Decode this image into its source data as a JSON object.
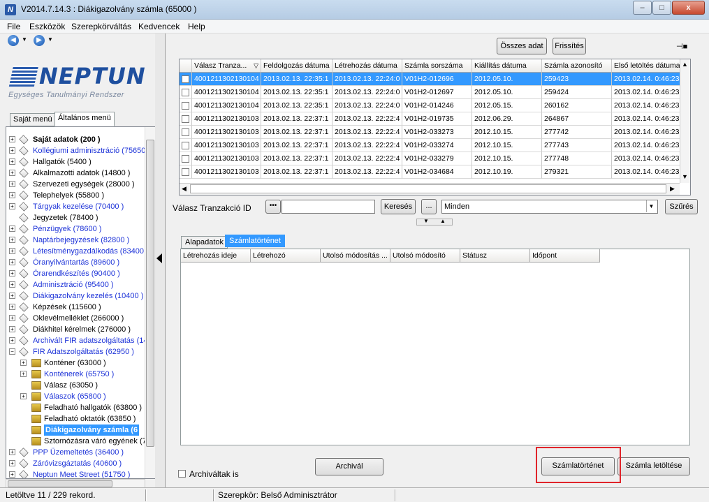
{
  "window": {
    "title": "V2014.7.14.3 : Diákigazolvány számla (65000 )",
    "app_icon": "N",
    "minimize": "–",
    "maximize": "□",
    "close": "x"
  },
  "menu": [
    "File",
    "Eszközök",
    "Szerepkörváltás",
    "Kedvencek",
    "Help"
  ],
  "logo": {
    "word": "NEPTUN",
    "subtitle": "Egységes Tanulmányi Rendszer"
  },
  "left_tabs": [
    "Saját menü",
    "Általános menü"
  ],
  "tree": [
    {
      "label": "Saját adatok (200  )"
    },
    {
      "label": "Kollégiumi adminisztráció  (75650"
    },
    {
      "label": "Hallgatók (5400  )"
    },
    {
      "label": "Alkalmazotti adatok (14800  )"
    },
    {
      "label": "Szervezeti egységek (28000  )"
    },
    {
      "label": "Telephelyek (55800  )"
    },
    {
      "label": "Tárgyak kezelése (70400  )"
    },
    {
      "label": "Jegyzetek (78400  )"
    },
    {
      "label": "Pénzügyek (78600  )"
    },
    {
      "label": "Naptárbejegyzések (82800  )"
    },
    {
      "label": "Létesítménygazdálkodás (83400"
    },
    {
      "label": "Óranyilvántartás (89600  )"
    },
    {
      "label": "Órarendkészítés (90400  )"
    },
    {
      "label": "Adminisztráció (95400  )"
    },
    {
      "label": "Diákigazolvány kezelés (10400  )"
    },
    {
      "label": "Képzések (115600  )"
    },
    {
      "label": "Oklevélmelléklet (266000  )"
    },
    {
      "label": "Diákhitel kérelmek (276000  )"
    },
    {
      "label": "Archivált FIR adatszolgáltatás (14"
    },
    {
      "label": "FIR Adatszolgáltatás (62950  )"
    },
    {
      "label": "Konténer (63000  )"
    },
    {
      "label": "Konténerek (65750  )"
    },
    {
      "label": "Válasz (63050  )"
    },
    {
      "label": "Válaszok (65800  )"
    },
    {
      "label": "Feladható hallgatók (63800  )"
    },
    {
      "label": "Feladható oktatók (63850  )"
    },
    {
      "label": "Diákigazolvány számla (6"
    },
    {
      "label": "Sztornózásra váró egyének (7"
    },
    {
      "label": "PPP Üzemeltetés (36400  )"
    },
    {
      "label": "Záróvizsgáztatás (40600  )"
    },
    {
      "label": "Neptun Meet Street (51750  )"
    }
  ],
  "toolbar": {
    "all_data": "Összes adat",
    "refresh": "Frissítés",
    "pin": "⊣■"
  },
  "grid": {
    "columns": [
      "Válasz Tranza...",
      "Feldolgozás dátuma",
      "Létrehozás dátuma",
      "Számla sorszáma",
      "Kiállítás dátuma",
      "Számla azonosító",
      "Első letöltés dátuma"
    ],
    "sort_marker": "▽",
    "rows": [
      [
        "4001211302130104",
        "2013.02.13. 22:35:1",
        "2013.02.13. 22:24:0",
        "V01H2-012696",
        "2012.05.10.",
        "259423",
        "2013.02.14. 0:46:23"
      ],
      [
        "4001211302130104",
        "2013.02.13. 22:35:1",
        "2013.02.13. 22:24:0",
        "V01H2-012697",
        "2012.05.10.",
        "259424",
        "2013.02.14. 0:46:23"
      ],
      [
        "4001211302130104",
        "2013.02.13. 22:35:1",
        "2013.02.13. 22:24:0",
        "V01H2-014246",
        "2012.05.15.",
        "260162",
        "2013.02.14. 0:46:23"
      ],
      [
        "4001211302130103",
        "2013.02.13. 22:37:1",
        "2013.02.13. 22:22:4",
        "V01H2-019735",
        "2012.06.29.",
        "264867",
        "2013.02.14. 0:46:23"
      ],
      [
        "4001211302130103",
        "2013.02.13. 22:37:1",
        "2013.02.13. 22:22:4",
        "V01H2-033273",
        "2012.10.15.",
        "277742",
        "2013.02.14. 0:46:23"
      ],
      [
        "4001211302130103",
        "2013.02.13. 22:37:1",
        "2013.02.13. 22:22:4",
        "V01H2-033274",
        "2012.10.15.",
        "277743",
        "2013.02.14. 0:46:23"
      ],
      [
        "4001211302130103",
        "2013.02.13. 22:37:1",
        "2013.02.13. 22:22:4",
        "V01H2-033279",
        "2012.10.15.",
        "277748",
        "2013.02.14. 0:46:23"
      ],
      [
        "4001211302130103",
        "2013.02.13. 22:37:1",
        "2013.02.13. 22:22:4",
        "V01H2-034684",
        "2012.10.19.",
        "279321",
        "2013.02.14. 0:46:23"
      ]
    ],
    "selected_row": 0
  },
  "filter": {
    "label": "Válasz Tranzakció ID",
    "dots": "•••",
    "input_value": "",
    "search": "Keresés",
    "ellipsis": "...",
    "dropdown_value": "Minden",
    "filter_button": "Szűrés"
  },
  "lower_tabs": [
    "Alapadatok",
    "Számlatörténet"
  ],
  "lower_grid": {
    "columns": [
      "Létrehozás ideje",
      "Létrehozó",
      "Utolsó módosítás ...",
      "Utolsó módosító",
      "Státusz",
      "Időpont"
    ]
  },
  "bottom": {
    "archived_label": "Archiváltak is",
    "archive_button": "Archivál",
    "history_button": "Számlatörténet",
    "download_button": "Számla letöltése"
  },
  "status": {
    "records": "Letöltve 11 / 229 rekord.",
    "role": "Szerepkör: Belső Adminisztrátor"
  },
  "colors": {
    "selection": "#3399ff",
    "link_blue": "#1d33d8",
    "logo_blue": "#1e4f9f",
    "highlight_red": "#e0242a"
  }
}
